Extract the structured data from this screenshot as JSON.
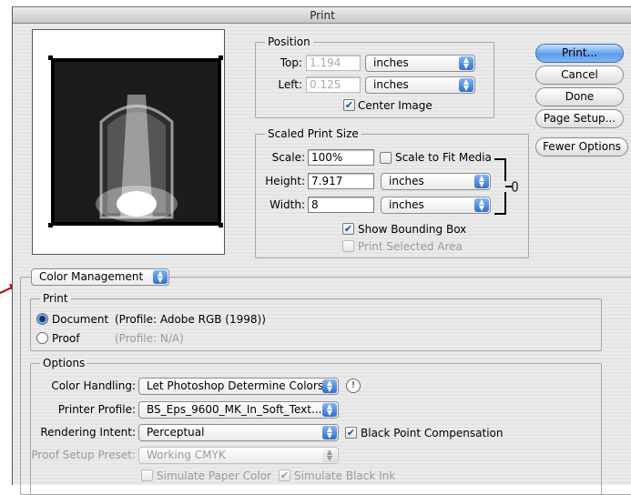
{
  "window": {
    "title": "Print"
  },
  "preview": {
    "image_desc": "photo preview"
  },
  "position": {
    "legend": "Position",
    "top_label": "Top:",
    "top_value": "1.194",
    "left_label": "Left:",
    "left_value": "0.125",
    "unit": "inches",
    "center_image": "Center Image"
  },
  "scaled": {
    "legend": "Scaled Print Size",
    "scale_label": "Scale:",
    "scale_value": "100%",
    "scale_to_fit": "Scale to Fit Media",
    "height_label": "Height:",
    "height_value": "7.917",
    "width_label": "Width:",
    "width_value": "8",
    "unit": "inches",
    "show_bounding_box": "Show Bounding Box",
    "print_selected_area": "Print Selected Area"
  },
  "buttons": {
    "print": "Print...",
    "cancel": "Cancel",
    "done": "Done",
    "page_setup": "Page Setup...",
    "fewer_options": "Fewer Options"
  },
  "color_mgmt": {
    "popup": "Color Management"
  },
  "print_group": {
    "legend": "Print",
    "document": "Document",
    "document_profile": "(Profile: Adobe RGB (1998))",
    "proof": "Proof",
    "proof_profile": "(Profile: N/A)"
  },
  "options": {
    "legend": "Options",
    "color_handling_label": "Color Handling:",
    "color_handling_value": "Let Photoshop Determine Colors",
    "printer_profile_label": "Printer Profile:",
    "printer_profile_value": "BS_Eps_9600_MK_In_Soft_Text...",
    "rendering_intent_label": "Rendering Intent:",
    "rendering_intent_value": "Perceptual",
    "black_point": "Black Point Compensation",
    "proof_setup_label": "Proof Setup Preset:",
    "proof_setup_value": "Working CMYK",
    "simulate_paper": "Simulate Paper Color",
    "simulate_ink": "Simulate Black Ink"
  },
  "colors": {
    "accent": "#4f8fe6",
    "arrow": "#b00000"
  }
}
